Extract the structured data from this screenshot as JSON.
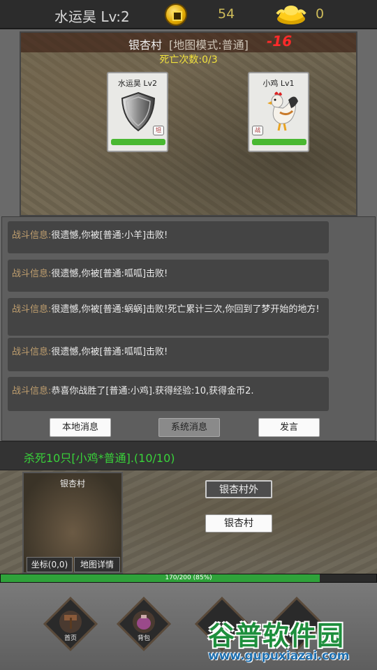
{
  "header": {
    "player_title": "水运昊 Lv:2",
    "coins": "54",
    "ingots": "0"
  },
  "battle": {
    "village_name": "银杏村",
    "map_mode": "[地图模式:普通]",
    "damage": "-16",
    "death_count": "死亡次数:0/3",
    "player": {
      "name": "水运昊 Lv2",
      "tag": "坦",
      "hp_fraction": 1.0,
      "icon": "shield-icon"
    },
    "enemy": {
      "name": "小鸡 Lv1",
      "tag": "战",
      "hp_fraction": 1.0,
      "icon": "chicken-icon"
    }
  },
  "log": {
    "label": "战斗信息:",
    "messages": [
      "很遗憾,你被[普通:小羊]击败!",
      "很遗憾,你被[普通:呱呱]击败!",
      "很遗憾,你被[普通:蜗蜗]击败!死亡累计三次,你回到了梦开始的地方!",
      "很遗憾,你被[普通:呱呱]击败!",
      "恭喜你战胜了[普通:小鸡].获得经验:10,获得金币2."
    ],
    "tabs": {
      "local": "本地消息",
      "system": "系统消息",
      "speak": "发言"
    }
  },
  "quest": {
    "text": "杀死10只[小鸡*普通].(10/10)"
  },
  "map": {
    "minimap_title": "银杏村",
    "coord_button": "坐标(0,0)",
    "detail_button": "地图详情",
    "locations": [
      "银杏村外",
      "银杏村"
    ]
  },
  "exp": {
    "text": "170/200 (85%)",
    "fraction": 0.85
  },
  "nav": {
    "home": "首页",
    "bag": "背包"
  },
  "watermark": {
    "text": "谷普软件园",
    "url": "www.gupuxiazai.com"
  },
  "colors": {
    "hp": "#49b832",
    "quest": "#39d23a",
    "damage": "#ff2a2a",
    "death": "#f2e23c"
  }
}
